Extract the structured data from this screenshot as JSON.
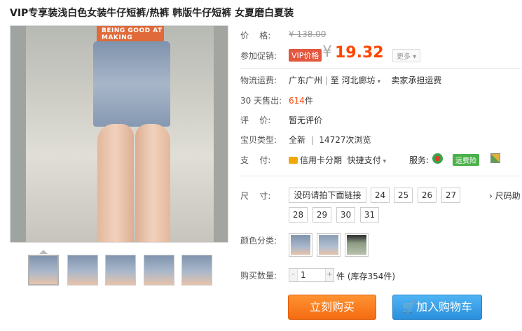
{
  "title": "VIP专享装浅白色女装牛仔短裤/热裤 韩版牛仔短裤 女夏磨白夏装",
  "image": {
    "shirt_text": "BEING GOOD AT\nMAKING",
    "zoom_icon": "magnifier-icon"
  },
  "price": {
    "label": "价    格:",
    "original": "¥ 138.00"
  },
  "promo": {
    "label": "参加促销:",
    "tag": "VIP价格",
    "currency": "¥",
    "value": "19.32",
    "more": "更多 ▾"
  },
  "shipping": {
    "label": "物流运费:",
    "from": "广东广州",
    "sep": "至",
    "to": "河北廊坊",
    "fee": "卖家承担运费"
  },
  "sales": {
    "label": "30 天售出:",
    "count": "614",
    "unit": "件"
  },
  "review": {
    "label": "评    价:",
    "value": "暂无评价"
  },
  "item_type": {
    "label": "宝贝类型:",
    "condition": "全新",
    "sep": "|",
    "views": "14727次浏览"
  },
  "payment": {
    "label": "支    付:",
    "method": "信用卡分期",
    "quick": "快捷支付",
    "service_label": "服务:",
    "insurance": "运费险"
  },
  "size": {
    "label": "尺    寸:",
    "first": "没码请拍下面链接",
    "options": [
      "24",
      "25",
      "26",
      "27",
      "28",
      "29",
      "30",
      "31"
    ],
    "guide": "› 尺码助"
  },
  "color": {
    "label": "颜色分类:"
  },
  "quantity": {
    "label": "购买数量:",
    "minus": "-",
    "value": "1",
    "plus": "+",
    "unit": "件",
    "stock": "(库存354件)"
  },
  "actions": {
    "buy": "立刻购买",
    "cart": "加入购物车"
  },
  "colors": {
    "price": "#ff4400",
    "buy": "#f46b12",
    "cart": "#2b8fdc"
  }
}
